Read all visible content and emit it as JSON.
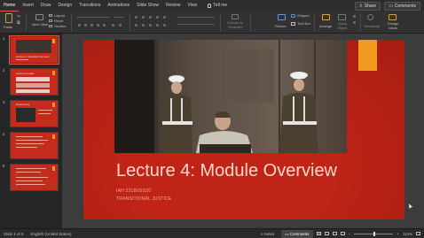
{
  "menu": {
    "tabs": [
      "Home",
      "Insert",
      "Draw",
      "Design",
      "Transitions",
      "Animations",
      "Slide Show",
      "Review",
      "View"
    ],
    "active_tab": "Home",
    "tell_me": "Tell me",
    "share": "Share",
    "comments": "Comments"
  },
  "ribbon": {
    "paste": "Paste",
    "new_slide": "New Slide",
    "layout": "Layout",
    "reset": "Reset",
    "section": "Section",
    "convert_to_smartart": "Convert to SmartArt",
    "picture": "Picture",
    "shapes": "Shapes",
    "text_box": "Text Box",
    "arrange": "Arrange",
    "quick_styles": "Quick Styles",
    "sensitivity": "Sensitivity",
    "design_ideas": "Design Ideas"
  },
  "slides": [
    {
      "number": "1",
      "selected": true,
      "thumb_title": "Lecture 4: Module Overview"
    },
    {
      "number": "2",
      "selected": false,
      "thumb_title": "Learning Goals"
    },
    {
      "number": "3",
      "selected": false,
      "thumb_title": "Nuremberg"
    },
    {
      "number": "4",
      "selected": false,
      "thumb_title": ""
    },
    {
      "number": "5",
      "selected": false,
      "thumb_title": ""
    }
  ],
  "slide": {
    "title": "Lecture 4: Module Overview",
    "course": "IAH 231B/ISS20",
    "subtitle": "TRANSITIONAL JUSTICE",
    "theme_color": "#bf2417",
    "accent_color": "#f29a1f"
  },
  "status": {
    "slide_of": "Slide 1 of 5",
    "language": "English (United States)",
    "notes": "Notes",
    "comments": "Comments",
    "zoom": "114%"
  }
}
